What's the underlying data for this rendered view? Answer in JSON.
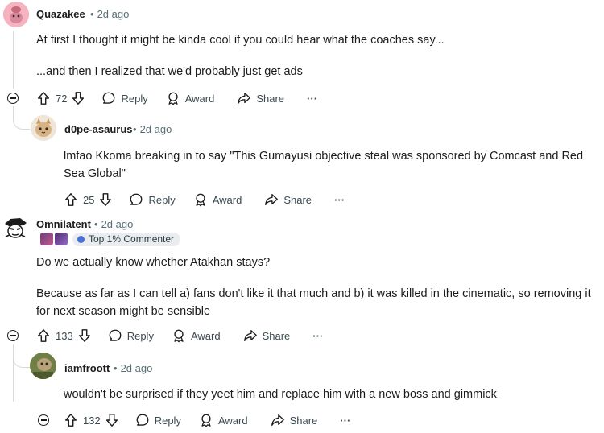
{
  "comments": [
    {
      "username": "Quazakee",
      "separator": "•",
      "time": "2d ago",
      "body": [
        "At first I thought it might be kinda cool if you could hear what the coaches say...",
        "...and then I realized that we'd probably just get ads"
      ],
      "votes": "72",
      "reply_label": "Reply",
      "award_label": "Award",
      "share_label": "Share",
      "more_label": "···"
    },
    {
      "username": "d0pe-asaurus",
      "separator": "•",
      "time": "2d ago",
      "body": [
        "lmfao Kkoma breaking in to say \"This Gumayusi objective steal was sponsored by Comcast and Red Sea Global\""
      ],
      "votes": "25",
      "reply_label": "Reply",
      "award_label": "Award",
      "share_label": "Share",
      "more_label": "···"
    },
    {
      "username": "Omnilatent",
      "separator": "•",
      "time": "2d ago",
      "flair_tag": "Top 1% Commenter",
      "body": [
        "Do we actually know whether Atakhan stays?",
        "Because as far as I can tell a) fans don't like it that much and b) it was killed in the cinematic, so removing it for next season might be sensible"
      ],
      "votes": "133",
      "reply_label": "Reply",
      "award_label": "Award",
      "share_label": "Share",
      "more_label": "···"
    },
    {
      "username": "iamfroott",
      "separator": "•",
      "time": "2d ago",
      "body": [
        "wouldn't be surprised if they yeet him and replace him with a new boss and gimmick"
      ],
      "votes": "132",
      "reply_label": "Reply",
      "award_label": "Award",
      "share_label": "Share",
      "more_label": "···"
    }
  ]
}
